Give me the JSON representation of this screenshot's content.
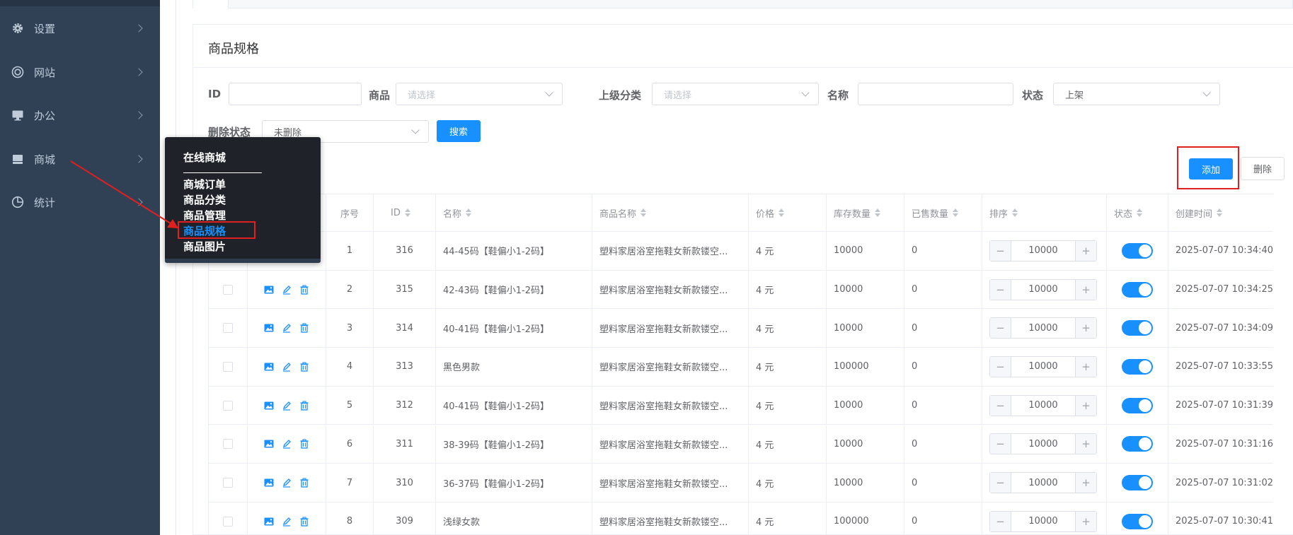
{
  "sidebar": {
    "items": [
      {
        "label": "设置",
        "icon": "gear-icon"
      },
      {
        "label": "网站",
        "icon": "globe-icon"
      },
      {
        "label": "办公",
        "icon": "monitor-icon"
      },
      {
        "label": "商城",
        "icon": "shop-icon"
      },
      {
        "label": "统计",
        "icon": "pie-chart-icon"
      }
    ]
  },
  "popup": {
    "title": "在线商城",
    "items": [
      "商城订单",
      "商品分类",
      "商品管理",
      "商品规格",
      "商品图片"
    ]
  },
  "card": {
    "title": "商品规格"
  },
  "filters": {
    "id_label": "ID",
    "id_value": "",
    "product_label": "商品",
    "product_placeholder": "请选择",
    "category_label": "上级分类",
    "category_placeholder": "请选择",
    "name_label": "名称",
    "name_value": "",
    "status_label": "状态",
    "status_value": "上架",
    "deleted_label": "删除状态",
    "deleted_value": "未删除",
    "search_button": "搜索"
  },
  "toolbar": {
    "add_button": "添加",
    "delete_button": "删除"
  },
  "colors": {
    "primary": "#1890ff",
    "sidebar_bg": "#304156",
    "popup_bg": "#1f2329",
    "highlight_red": "#e02020"
  },
  "table": {
    "headers": {
      "index": "序号",
      "id": "ID",
      "name": "名称",
      "product_name": "商品名称",
      "price": "价格",
      "stock": "库存数量",
      "sold": "已售数量",
      "sort": "排序",
      "status": "状态",
      "created": "创建时间"
    },
    "rows": [
      {
        "index": "1",
        "id": "316",
        "name": "44-45码【鞋偏小1-2码】",
        "product_name": "塑料家居浴室拖鞋女新款镂空...",
        "price": "4 元",
        "stock": "10000",
        "sold": "0",
        "sort": "10000",
        "status_on": true,
        "created": "2025-07-07 10:34:40"
      },
      {
        "index": "2",
        "id": "315",
        "name": "42-43码【鞋偏小1-2码】",
        "product_name": "塑料家居浴室拖鞋女新款镂空...",
        "price": "4 元",
        "stock": "10000",
        "sold": "0",
        "sort": "10000",
        "status_on": true,
        "created": "2025-07-07 10:34:25"
      },
      {
        "index": "3",
        "id": "314",
        "name": "40-41码【鞋偏小1-2码】",
        "product_name": "塑料家居浴室拖鞋女新款镂空...",
        "price": "4 元",
        "stock": "10000",
        "sold": "0",
        "sort": "10000",
        "status_on": true,
        "created": "2025-07-07 10:34:09"
      },
      {
        "index": "4",
        "id": "313",
        "name": "黑色男款",
        "product_name": "塑料家居浴室拖鞋女新款镂空...",
        "price": "4 元",
        "stock": "100000",
        "sold": "0",
        "sort": "10000",
        "status_on": true,
        "created": "2025-07-07 10:33:55"
      },
      {
        "index": "5",
        "id": "312",
        "name": "40-41码【鞋偏小1-2码】",
        "product_name": "塑料家居浴室拖鞋女新款镂空...",
        "price": "4 元",
        "stock": "10000",
        "sold": "0",
        "sort": "10000",
        "status_on": true,
        "created": "2025-07-07 10:31:39"
      },
      {
        "index": "6",
        "id": "311",
        "name": "38-39码【鞋偏小1-2码】",
        "product_name": "塑料家居浴室拖鞋女新款镂空...",
        "price": "4 元",
        "stock": "10000",
        "sold": "0",
        "sort": "10000",
        "status_on": true,
        "created": "2025-07-07 10:31:16"
      },
      {
        "index": "7",
        "id": "310",
        "name": "36-37码【鞋偏小1-2码】",
        "product_name": "塑料家居浴室拖鞋女新款镂空...",
        "price": "4 元",
        "stock": "10000",
        "sold": "0",
        "sort": "10000",
        "status_on": true,
        "created": "2025-07-07 10:31:02"
      },
      {
        "index": "8",
        "id": "309",
        "name": "浅绿女款",
        "product_name": "塑料家居浴室拖鞋女新款镂空...",
        "price": "4 元",
        "stock": "100000",
        "sold": "0",
        "sort": "10000",
        "status_on": true,
        "created": "2025-07-07 10:30:41"
      }
    ]
  }
}
